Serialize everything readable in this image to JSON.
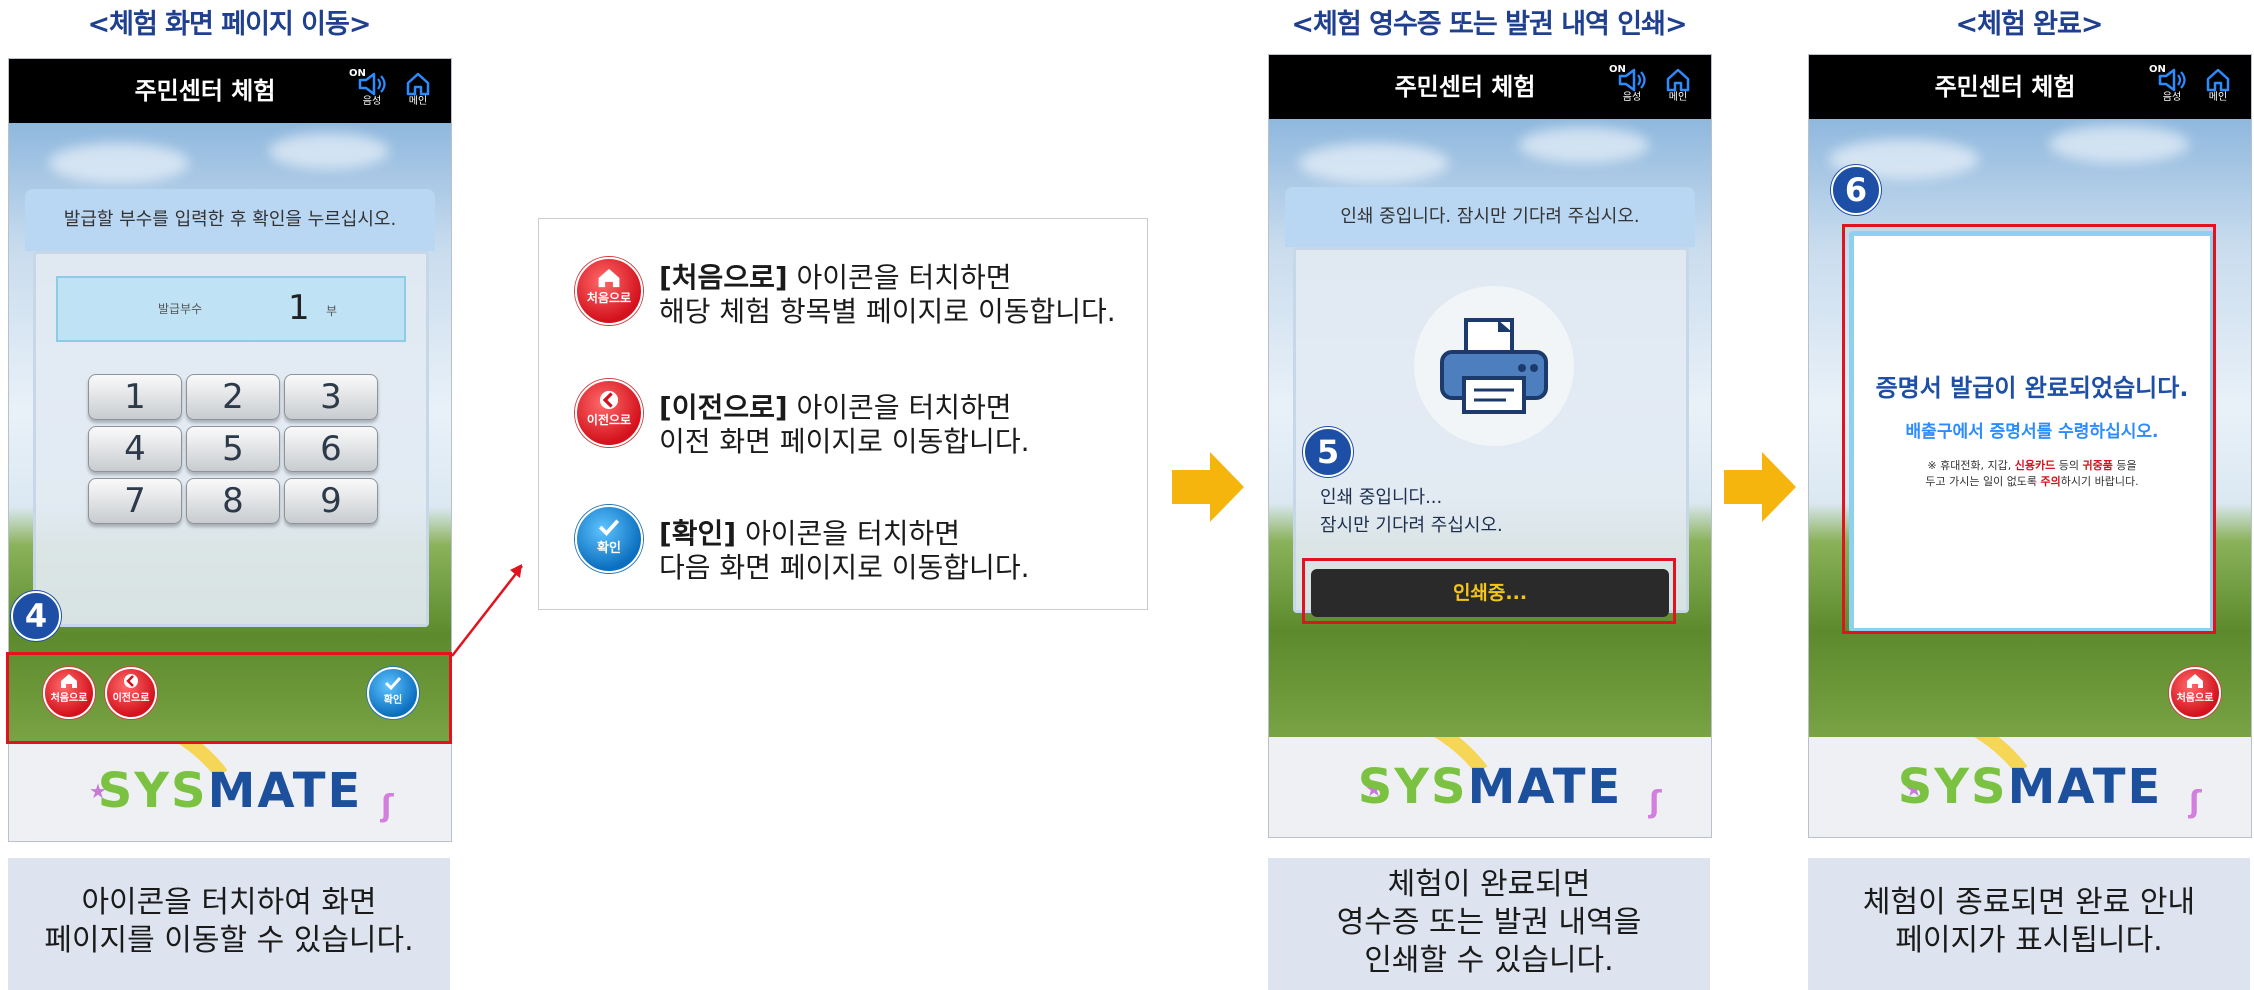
{
  "sections": {
    "s1_title": "<체험 화면 페이지 이동>",
    "s2_title": "<체험 영수증 또는 발권 내역 인쇄>",
    "s3_title": "<체험 완료>"
  },
  "header": {
    "title": "주민센터 체험",
    "sound_label": "음성",
    "sound_on": "ON",
    "home_label": "메인"
  },
  "screen1": {
    "instruction": "발급할 부수를 입력한 후 확인을 누르십시오.",
    "copies_label": "발급부수",
    "copies_value": "1",
    "copies_unit": "부",
    "keys": [
      "1",
      "2",
      "3",
      "4",
      "5",
      "6",
      "7",
      "8",
      "9"
    ],
    "step": "4",
    "btn_home": "처음으로",
    "btn_back": "이전으로",
    "btn_confirm": "확인"
  },
  "info": {
    "home_title": "[처음으로]",
    "home_line1": " 아이콘을 터치하면",
    "home_line2": "해당 체험 항목별 페이지로 이동합니다.",
    "home_icon_label": "처음으로",
    "back_title": "[이전으로]",
    "back_line1": " 아이콘을 터치하면",
    "back_line2": "이전 화면 페이지로 이동합니다.",
    "back_icon_label": "이전으로",
    "ok_title": "[확인]",
    "ok_line1": " 아이콘을 터치하면",
    "ok_line2": "다음 화면 페이지로 이동합니다.",
    "ok_icon_label": "확인"
  },
  "screen2": {
    "instruction": "인쇄 중입니다. 잠시만 기다려 주십시오.",
    "step": "5",
    "msg_line1": "인쇄 중입니다...",
    "msg_line2": "잠시만 기다려 주십시오.",
    "status_button": "인쇄중..."
  },
  "screen3": {
    "step": "6",
    "done_title": "증명서 발급이 완료되었습니다.",
    "done_sub": "배출구에서 증명서를 수령하십시오.",
    "note_prefix": "※ 휴대전화, 지갑, ",
    "note_card": "신용카드",
    "note_mid": " 등의 ",
    "note_valuables": "귀중품",
    "note_after": " 등을",
    "note_line2_pre": "두고 가시는 일이 없도록 ",
    "note_caution": "주의",
    "note_line2_post": "하시기 바랍니다.",
    "btn_home": "처음으로"
  },
  "brand": {
    "sys": "SYS",
    "mate": "MATE"
  },
  "captions": {
    "c1_line1": "아이콘을 터치하여 화면",
    "c1_line2": "페이지를 이동할 수 있습니다.",
    "c2_line1": "체험이 완료되면",
    "c2_line2": "영수증 또는 발권 내역을",
    "c2_line3": "인쇄할 수 있습니다.",
    "c3_line1": "체험이 종료되면 완료 안내",
    "c3_line2": "페이지가 표시됩니다."
  },
  "colors": {
    "title_blue": "#1f3f8f",
    "highlight_red": "#e0141e",
    "arrow_yellow": "#f5b50c",
    "step_blue": "#1d4fa6"
  }
}
